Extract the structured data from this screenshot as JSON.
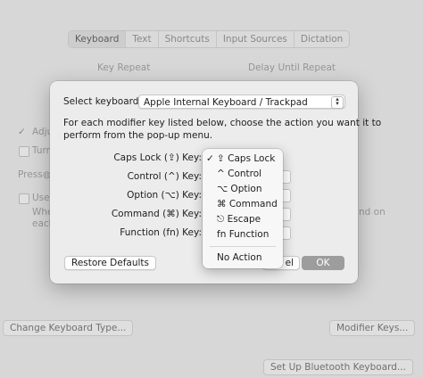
{
  "tabs": [
    {
      "label": "Keyboard",
      "selected": true
    },
    {
      "label": "Text",
      "selected": false
    },
    {
      "label": "Shortcuts",
      "selected": false
    },
    {
      "label": "Input Sources",
      "selected": false
    },
    {
      "label": "Dictation",
      "selected": false
    }
  ],
  "background": {
    "key_repeat_label": "Key Repeat",
    "delay_label": "Delay Until Repeat",
    "partial_adjust": "Adju",
    "partial_turn": "Turn",
    "partial_press": "Press",
    "partial_use": "Use",
    "partial_when": "Whe",
    "partial_each": "each",
    "partial_nd_on": "nd on",
    "change_keyboard_type": "Change Keyboard Type...",
    "modifier_keys": "Modifier Keys...",
    "bluetooth_keyboard": "Set Up Bluetooth Keyboard..."
  },
  "sheet": {
    "select_keyboard_label": "Select keyboard:",
    "selected_keyboard": "Apple Internal Keyboard / Trackpad",
    "instructions_line1": "For each modifier key listed below, choose the action you want it to",
    "instructions_line2": "perform from the pop-up menu.",
    "rows": [
      {
        "label": "Caps Lock (⇪) Key:"
      },
      {
        "label": "Control (^) Key:"
      },
      {
        "label": "Option (⌥) Key:"
      },
      {
        "label": "Command (⌘) Key:"
      },
      {
        "label": "Function (fn) Key:"
      }
    ],
    "restore_defaults": "Restore Defaults",
    "cancel_partial": "el",
    "ok": "OK"
  },
  "menu": {
    "items": [
      {
        "label": "⇪ Caps Lock",
        "checked": true
      },
      {
        "label": "^ Control",
        "checked": false
      },
      {
        "label": "⌥ Option",
        "checked": false
      },
      {
        "label": "⌘ Command",
        "checked": false
      },
      {
        "label": "⎋ Escape",
        "checked": false
      },
      {
        "label": "fn Function",
        "checked": false
      }
    ],
    "no_action": "No Action",
    "check_glyph": "✓"
  }
}
